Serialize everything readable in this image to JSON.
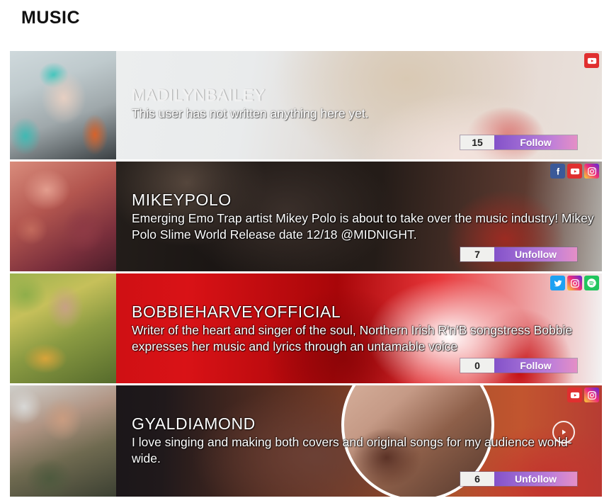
{
  "page": {
    "title": "MUSIC"
  },
  "cards": [
    {
      "username": "MADILYNBAILEY",
      "bio": "This user has not written anything here yet.",
      "follow_count": "15",
      "follow_label": "Follow",
      "social_icons": [
        "youtube-icon"
      ],
      "has_play_badge": false
    },
    {
      "username": "MIKEYPOLO",
      "bio": "Emerging Emo Trap artist Mikey Polo is about to take over the music industry! Mikey Polo Slime World Release date 12/18 @MIDNIGHT.",
      "follow_count": "7",
      "follow_label": "Unfollow",
      "social_icons": [
        "facebook-icon",
        "youtube-icon",
        "instagram-icon"
      ],
      "has_play_badge": false
    },
    {
      "username": "BOBBIEHARVEYOFFICIAL",
      "bio": "Writer of the heart and singer of the soul, Northern Irish R'n'B songstress Bobbie expresses her music and lyrics through an untamable voice",
      "follow_count": "0",
      "follow_label": "Follow",
      "social_icons": [
        "twitter-icon",
        "instagram-icon",
        "spotify-icon"
      ],
      "has_play_badge": false
    },
    {
      "username": "GYALDIAMOND",
      "bio": "I love singing and making both covers and original songs for my audience world-wide.",
      "follow_count": "6",
      "follow_label": "Unfollow",
      "social_icons": [
        "youtube-icon",
        "instagram-icon"
      ],
      "has_play_badge": true
    }
  ],
  "colors": {
    "accent_purple": "#8452c9",
    "accent_pink": "#e58fc6",
    "count_bg": "#f0f0ee",
    "youtube": "#e02f2f",
    "facebook": "#3b5998",
    "twitter": "#1da1f2",
    "spotify": "#22c55e",
    "page_bg": "#ffffff"
  }
}
